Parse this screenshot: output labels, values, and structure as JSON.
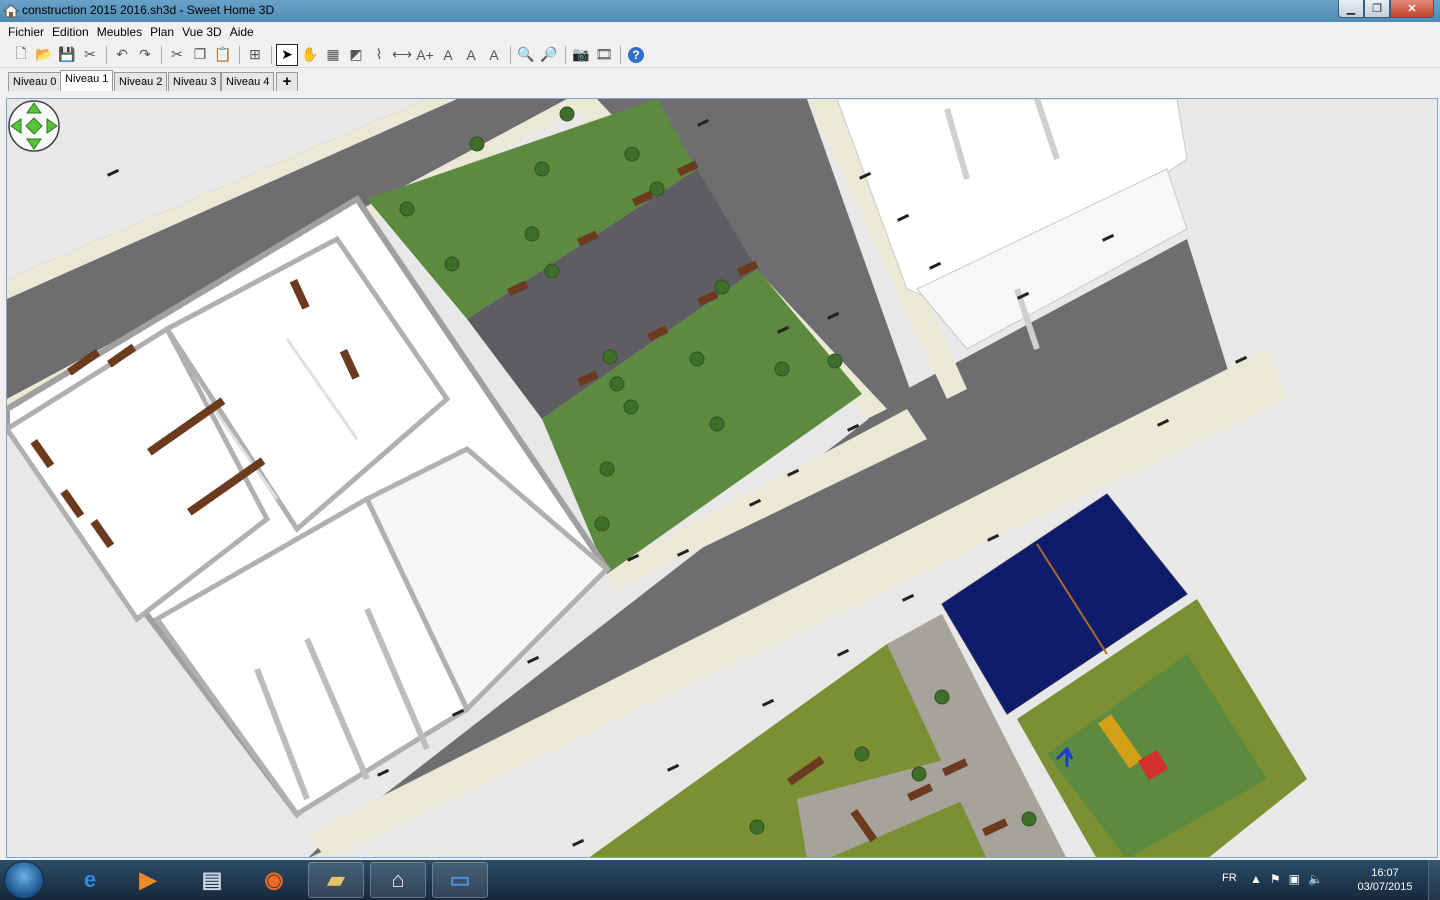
{
  "window": {
    "title": "construction 2015 2016.sh3d - Sweet Home 3D",
    "app_icon": "sweet-home-3d-icon",
    "controls": [
      "minimize-icon",
      "maximize-icon",
      "close-icon"
    ]
  },
  "menu": {
    "items": [
      "Fichier",
      "Edition",
      "Meubles",
      "Plan",
      "Vue 3D",
      "Aide"
    ]
  },
  "toolbar": {
    "buttons": [
      {
        "name": "new-icon",
        "glyph": "🗋"
      },
      {
        "name": "open-icon",
        "glyph": "📂"
      },
      {
        "name": "save-icon",
        "glyph": "💾"
      },
      {
        "name": "cut-tool-icon",
        "glyph": "✂"
      },
      {
        "name": "undo-icon",
        "glyph": "↶"
      },
      {
        "name": "redo-icon",
        "glyph": "↷"
      },
      {
        "name": "cut-icon",
        "glyph": "✂"
      },
      {
        "name": "copy-icon",
        "glyph": "❐"
      },
      {
        "name": "paste-icon",
        "glyph": "📋"
      },
      {
        "name": "add-furniture-icon",
        "glyph": "⊞"
      },
      {
        "name": "select-mode-icon",
        "glyph": "➤",
        "active": true
      },
      {
        "name": "pan-mode-icon",
        "glyph": "✋"
      },
      {
        "name": "create-walls-icon",
        "glyph": "▦"
      },
      {
        "name": "create-rooms-icon",
        "glyph": "◩"
      },
      {
        "name": "create-polylines-icon",
        "glyph": "⌇"
      },
      {
        "name": "create-dimensions-icon",
        "glyph": "⟷"
      },
      {
        "name": "add-text-icon",
        "glyph": "A+"
      },
      {
        "name": "text-style-icon",
        "glyph": "A"
      },
      {
        "name": "increase-text-icon",
        "glyph": "A"
      },
      {
        "name": "decrease-text-icon",
        "glyph": "A"
      },
      {
        "name": "zoom-in-icon",
        "glyph": "🔍"
      },
      {
        "name": "zoom-out-icon",
        "glyph": "🔎"
      },
      {
        "name": "create-photo-icon",
        "glyph": "📷"
      },
      {
        "name": "create-video-icon",
        "glyph": "🎞"
      },
      {
        "name": "help-icon",
        "glyph": "?"
      }
    ]
  },
  "levels": {
    "tabs": [
      "Niveau 0",
      "Niveau 1",
      "Niveau 2",
      "Niveau 3",
      "Niveau 4"
    ],
    "selected": "Niveau 1",
    "add_label": "+"
  },
  "plan": {
    "colors": {
      "road": "#6e6e70",
      "sidewalk": "#ece8d6",
      "grass": "#5c8a3e",
      "olive_grass": "#7c8f33",
      "building": "#ffffff",
      "wall": "#b8b8b8",
      "roof": "#0d1d6b",
      "bench": "#6b3a1f",
      "parking": "#5e5e62"
    },
    "compass_icon": "navigation-arrows-icon"
  },
  "taskbar": {
    "start_icon": "windows-start-icon",
    "apps": [
      {
        "name": "internet-explorer-icon",
        "open": false
      },
      {
        "name": "media-player-icon",
        "open": false
      },
      {
        "name": "network-app-icon",
        "open": false
      },
      {
        "name": "firefox-icon",
        "open": false
      },
      {
        "name": "file-explorer-icon",
        "open": true
      },
      {
        "name": "sweet-home-3d-taskbar-icon",
        "open": true
      },
      {
        "name": "odf-document-icon",
        "open": true
      }
    ],
    "language": "FR",
    "tray": [
      "show-hidden-icons-icon",
      "action-center-flag-icon",
      "network-icon",
      "volume-icon"
    ],
    "time": "16:07",
    "date": "03/07/2015"
  }
}
